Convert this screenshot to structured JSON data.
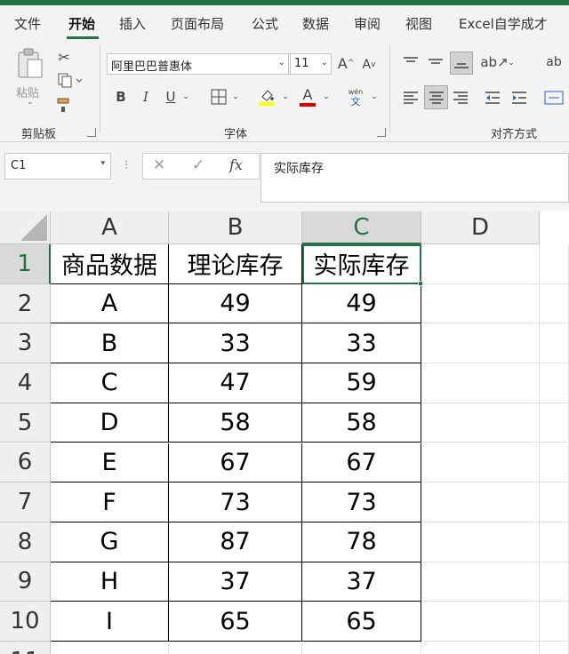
{
  "tabs": [
    "文件",
    "开始",
    "插入",
    "页面布局",
    "公式",
    "数据",
    "审阅",
    "视图",
    "Excel自学成才"
  ],
  "ribbon": {
    "clipboard": {
      "paste_label": "粘贴",
      "group_label": "剪贴板"
    },
    "font": {
      "font_name": "阿里巴巴普惠体",
      "font_size": "11",
      "bold": "B",
      "italic": "I",
      "underline": "U",
      "font_color_letter": "A",
      "wen_top": "wén",
      "wen_bottom": "文",
      "group_label": "字体",
      "grow_font": "A",
      "shrink_font": "A"
    },
    "alignment": {
      "group_label": "对齐方式"
    },
    "colors": {
      "fill_bar": "#ffff00",
      "font_bar": "#e00000",
      "accent": "#217346"
    }
  },
  "formula_bar": {
    "name_box": "C1",
    "cancel": "✕",
    "enter": "✓",
    "fx": "fx",
    "content": "实际库存"
  },
  "sheet": {
    "columns": [
      "A",
      "B",
      "C",
      "D"
    ],
    "rows": [
      "1",
      "2",
      "3",
      "4",
      "5",
      "6",
      "7",
      "8",
      "9",
      "10",
      "11"
    ],
    "cells": [
      [
        "商品数据",
        "理论库存",
        "实际库存"
      ],
      [
        "A",
        "49",
        "49"
      ],
      [
        "B",
        "33",
        "33"
      ],
      [
        "C",
        "47",
        "59"
      ],
      [
        "D",
        "58",
        "58"
      ],
      [
        "E",
        "67",
        "67"
      ],
      [
        "F",
        "73",
        "73"
      ],
      [
        "G",
        "87",
        "78"
      ],
      [
        "H",
        "37",
        "37"
      ],
      [
        "I",
        "65",
        "65"
      ]
    ]
  }
}
